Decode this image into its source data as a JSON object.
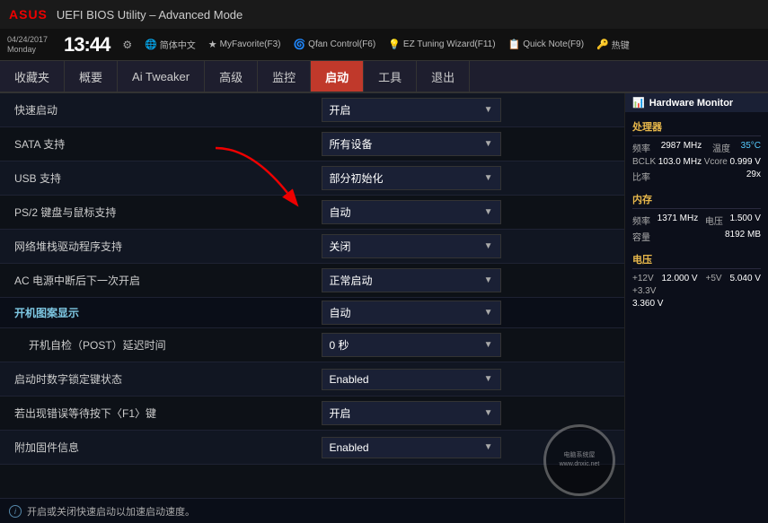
{
  "titleBar": {
    "logo": "ASUS",
    "title": "UEFI BIOS Utility – Advanced Mode"
  },
  "infoBar": {
    "date": "04/24/2017",
    "day": "Monday",
    "time": "13:44",
    "gearLabel": "⚙",
    "buttons": [
      {
        "icon": "🌐",
        "label": "简体中文"
      },
      {
        "icon": "★",
        "label": "MyFavorite(F3)"
      },
      {
        "icon": "🌀",
        "label": "Qfan Control(F6)"
      },
      {
        "icon": "💡",
        "label": "EZ Tuning Wizard(F11)"
      },
      {
        "icon": "📋",
        "label": "Quick Note(F9)"
      },
      {
        "icon": "🔑",
        "label": "热键"
      }
    ]
  },
  "nav": {
    "items": [
      {
        "label": "收藏夹",
        "active": false
      },
      {
        "label": "概要",
        "active": false
      },
      {
        "label": "Ai Tweaker",
        "active": false
      },
      {
        "label": "高级",
        "active": false
      },
      {
        "label": "监控",
        "active": false
      },
      {
        "label": "启动",
        "active": true
      },
      {
        "label": "工具",
        "active": false
      },
      {
        "label": "退出",
        "active": false
      }
    ]
  },
  "settings": [
    {
      "type": "row",
      "label": "快速启动",
      "sub": false,
      "value": "开启"
    },
    {
      "type": "row",
      "label": "SATA 支持",
      "sub": false,
      "value": "所有设备"
    },
    {
      "type": "row",
      "label": "USB 支持",
      "sub": false,
      "value": "部分初始化"
    },
    {
      "type": "row",
      "label": "PS/2 键盘与鼠标支持",
      "sub": false,
      "value": "自动"
    },
    {
      "type": "row",
      "label": "网络堆栈驱动程序支持",
      "sub": false,
      "value": "关闭"
    },
    {
      "type": "row",
      "label": "AC 电源中断后下一次开启",
      "sub": false,
      "value": "正常启动"
    },
    {
      "type": "section",
      "label": "开机图案显示",
      "sub": false,
      "value": "自动"
    },
    {
      "type": "row",
      "label": "开机自检（POST）延迟时间",
      "sub": true,
      "value": "0 秒"
    },
    {
      "type": "row",
      "label": "启动时数字锁定键状态",
      "sub": false,
      "value": "Enabled"
    },
    {
      "type": "row",
      "label": "若出现错误等待按下〈F1〉键",
      "sub": false,
      "value": "开启"
    },
    {
      "type": "row",
      "label": "附加固件信息",
      "sub": false,
      "value": "Enabled"
    }
  ],
  "statusBar": {
    "infoIcon": "i",
    "text": "开启或关闭快速启动以加速启动速度。"
  },
  "rightPanel": {
    "title": "Hardware Monitor",
    "titleIcon": "📊",
    "sections": [
      {
        "name": "处理器",
        "rows": [
          {
            "label": "频率",
            "value": "2987 MHz",
            "label2": "温度",
            "value2": "35°C"
          },
          {
            "label": "BCLK",
            "value": "103.0 MHz",
            "label2": "Vcore",
            "value2": "0.999 V"
          },
          {
            "label": "比率",
            "value": "29x",
            "label2": "",
            "value2": ""
          }
        ]
      },
      {
        "name": "内存",
        "rows": [
          {
            "label": "频率",
            "value": "1371 MHz",
            "label2": "电压",
            "value2": "1.500 V"
          },
          {
            "label": "容量",
            "value": "8192 MB",
            "label2": "",
            "value2": ""
          }
        ]
      },
      {
        "name": "电压",
        "rows": [
          {
            "label": "+12V",
            "value": "12.000 V",
            "label2": "+5V",
            "value2": "5.040 V"
          },
          {
            "label": "+3.3V",
            "value": "",
            "label2": "",
            "value2": ""
          },
          {
            "label": "3.360 V",
            "value": "",
            "label2": "",
            "value2": ""
          }
        ]
      }
    ]
  },
  "watermark": {
    "line1": "电脑系统屋",
    "line2": "www.dnxic.net"
  }
}
